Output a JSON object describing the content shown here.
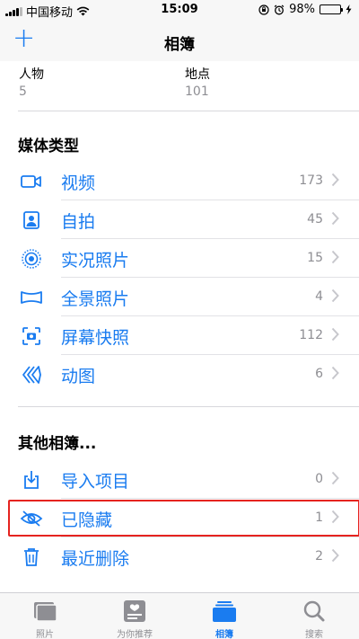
{
  "status_bar": {
    "carrier": "中国移动",
    "time": "15:09",
    "battery": "98%",
    "battery_level": 0.98
  },
  "nav": {
    "add_symbol": "+",
    "title": "相簿"
  },
  "top_row": [
    {
      "title": "人物",
      "count": "5"
    },
    {
      "title": "地点",
      "count": "101"
    }
  ],
  "media_types": {
    "title": "媒体类型",
    "items": [
      {
        "label": "视频",
        "count": "173",
        "icon": "video-icon"
      },
      {
        "label": "自拍",
        "count": "45",
        "icon": "selfie-icon"
      },
      {
        "label": "实况照片",
        "count": "15",
        "icon": "live-photo-icon"
      },
      {
        "label": "全景照片",
        "count": "4",
        "icon": "panorama-icon"
      },
      {
        "label": "屏幕快照",
        "count": "112",
        "icon": "screenshot-icon"
      },
      {
        "label": "动图",
        "count": "6",
        "icon": "animated-icon"
      }
    ]
  },
  "other_albums": {
    "title": "其他相簿...",
    "items": [
      {
        "label": "导入项目",
        "count": "0",
        "icon": "import-icon"
      },
      {
        "label": "已隐藏",
        "count": "1",
        "icon": "hidden-eye-icon"
      },
      {
        "label": "最近删除",
        "count": "2",
        "icon": "trash-icon"
      }
    ]
  },
  "tabs": [
    {
      "label": "照片",
      "icon": "photos-tab-icon"
    },
    {
      "label": "为你推荐",
      "icon": "for-you-tab-icon"
    },
    {
      "label": "相簿",
      "icon": "albums-tab-icon"
    },
    {
      "label": "搜索",
      "icon": "search-tab-icon"
    }
  ],
  "colors": {
    "accent": "#1a7cf0",
    "highlight": "#e5231f",
    "secondary_text": "#8e8e93",
    "battery_fill": "#4cd964"
  }
}
